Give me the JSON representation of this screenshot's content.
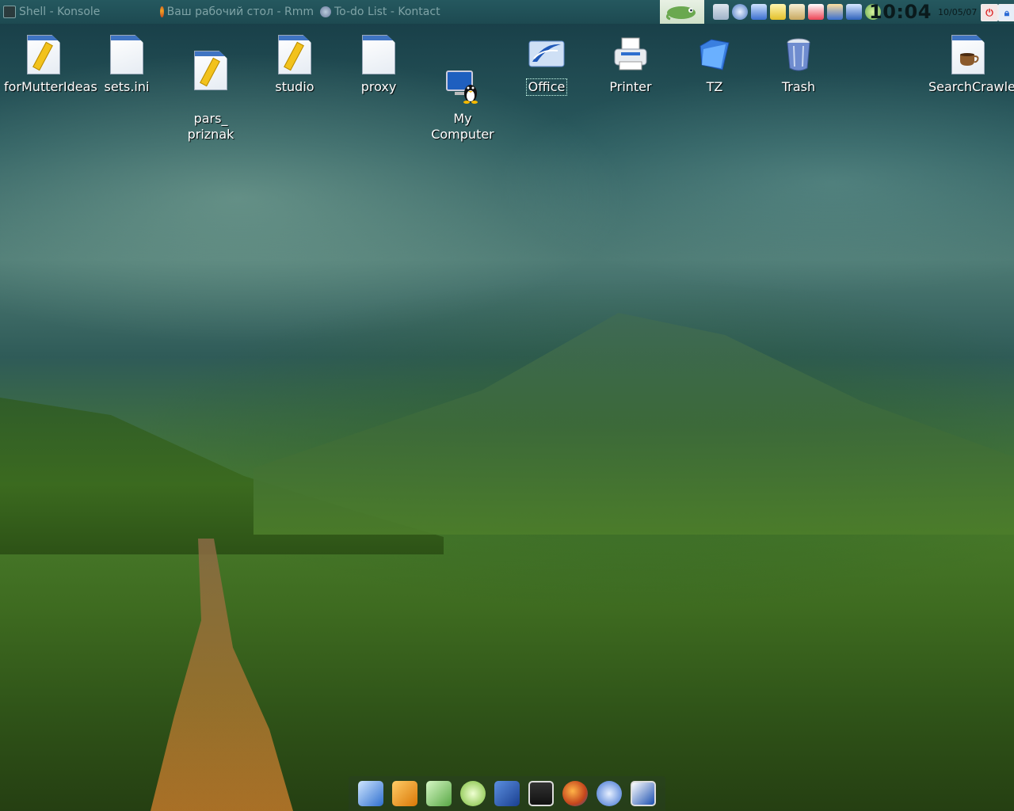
{
  "panel": {
    "tasks": [
      {
        "label": "Shell - Konsole",
        "icon": "konsole-icon"
      },
      {
        "label": "Ваш рабочий стол - Rmm",
        "icon": "firefox-icon"
      },
      {
        "label": "To-do List - Kontact",
        "icon": "kontact-icon"
      }
    ],
    "launcher": {
      "icon": "suse-gecko-icon",
      "color": "#6aa84f"
    },
    "tray": [
      "volume-icon",
      "network-globe-icon",
      "network-icon",
      "notes-icon",
      "clipboard-icon",
      "calendar-icon",
      "user-icon",
      "network-manager-icon",
      "update-icon"
    ],
    "clock": "10:04",
    "date": "10/05/07",
    "buttons": [
      {
        "name": "logout-button",
        "icon": "power-icon",
        "color": "#d22"
      },
      {
        "name": "lock-button",
        "icon": "lock-icon",
        "color": "#2a6bd6"
      }
    ]
  },
  "desktop": {
    "icons": [
      {
        "label": "forMutterIdeas",
        "icon": "text-file-icon"
      },
      {
        "label": "sets.ini",
        "icon": "text-file-icon"
      },
      {
        "label": "pars_\npriznak",
        "icon": "text-file-icon"
      },
      {
        "label": "studio",
        "icon": "text-file-icon"
      },
      {
        "label": "proxy",
        "icon": "text-file-icon"
      },
      {
        "label": "My\nComputer",
        "icon": "my-computer-icon"
      },
      {
        "label": "Office",
        "icon": "office-icon"
      },
      {
        "label": "Printer",
        "icon": "printer-icon"
      },
      {
        "label": "TZ",
        "icon": "folder-icon"
      },
      {
        "label": "Trash",
        "icon": "trash-icon"
      },
      {
        "label": "SearchCrawler.java",
        "icon": "java-file-icon"
      }
    ]
  },
  "dock": {
    "items": [
      "kde-write-icon",
      "box-icon",
      "calculator-icon",
      "update-icon",
      "kde-gear-icon",
      "terminal-icon",
      "firefox-icon",
      "network-globe-icon",
      "ide-icon"
    ]
  }
}
